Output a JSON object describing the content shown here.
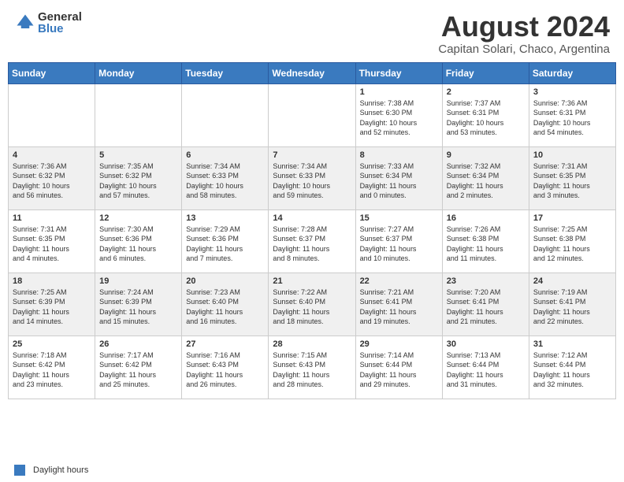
{
  "logo": {
    "general": "General",
    "blue": "Blue"
  },
  "header": {
    "month_year": "August 2024",
    "location": "Capitan Solari, Chaco, Argentina"
  },
  "days_of_week": [
    "Sunday",
    "Monday",
    "Tuesday",
    "Wednesday",
    "Thursday",
    "Friday",
    "Saturday"
  ],
  "footer": {
    "legend_label": "Daylight hours"
  },
  "weeks": [
    [
      {
        "day": "",
        "info": ""
      },
      {
        "day": "",
        "info": ""
      },
      {
        "day": "",
        "info": ""
      },
      {
        "day": "",
        "info": ""
      },
      {
        "day": "1",
        "info": "Sunrise: 7:38 AM\nSunset: 6:30 PM\nDaylight: 10 hours\nand 52 minutes."
      },
      {
        "day": "2",
        "info": "Sunrise: 7:37 AM\nSunset: 6:31 PM\nDaylight: 10 hours\nand 53 minutes."
      },
      {
        "day": "3",
        "info": "Sunrise: 7:36 AM\nSunset: 6:31 PM\nDaylight: 10 hours\nand 54 minutes."
      }
    ],
    [
      {
        "day": "4",
        "info": "Sunrise: 7:36 AM\nSunset: 6:32 PM\nDaylight: 10 hours\nand 56 minutes."
      },
      {
        "day": "5",
        "info": "Sunrise: 7:35 AM\nSunset: 6:32 PM\nDaylight: 10 hours\nand 57 minutes."
      },
      {
        "day": "6",
        "info": "Sunrise: 7:34 AM\nSunset: 6:33 PM\nDaylight: 10 hours\nand 58 minutes."
      },
      {
        "day": "7",
        "info": "Sunrise: 7:34 AM\nSunset: 6:33 PM\nDaylight: 10 hours\nand 59 minutes."
      },
      {
        "day": "8",
        "info": "Sunrise: 7:33 AM\nSunset: 6:34 PM\nDaylight: 11 hours\nand 0 minutes."
      },
      {
        "day": "9",
        "info": "Sunrise: 7:32 AM\nSunset: 6:34 PM\nDaylight: 11 hours\nand 2 minutes."
      },
      {
        "day": "10",
        "info": "Sunrise: 7:31 AM\nSunset: 6:35 PM\nDaylight: 11 hours\nand 3 minutes."
      }
    ],
    [
      {
        "day": "11",
        "info": "Sunrise: 7:31 AM\nSunset: 6:35 PM\nDaylight: 11 hours\nand 4 minutes."
      },
      {
        "day": "12",
        "info": "Sunrise: 7:30 AM\nSunset: 6:36 PM\nDaylight: 11 hours\nand 6 minutes."
      },
      {
        "day": "13",
        "info": "Sunrise: 7:29 AM\nSunset: 6:36 PM\nDaylight: 11 hours\nand 7 minutes."
      },
      {
        "day": "14",
        "info": "Sunrise: 7:28 AM\nSunset: 6:37 PM\nDaylight: 11 hours\nand 8 minutes."
      },
      {
        "day": "15",
        "info": "Sunrise: 7:27 AM\nSunset: 6:37 PM\nDaylight: 11 hours\nand 10 minutes."
      },
      {
        "day": "16",
        "info": "Sunrise: 7:26 AM\nSunset: 6:38 PM\nDaylight: 11 hours\nand 11 minutes."
      },
      {
        "day": "17",
        "info": "Sunrise: 7:25 AM\nSunset: 6:38 PM\nDaylight: 11 hours\nand 12 minutes."
      }
    ],
    [
      {
        "day": "18",
        "info": "Sunrise: 7:25 AM\nSunset: 6:39 PM\nDaylight: 11 hours\nand 14 minutes."
      },
      {
        "day": "19",
        "info": "Sunrise: 7:24 AM\nSunset: 6:39 PM\nDaylight: 11 hours\nand 15 minutes."
      },
      {
        "day": "20",
        "info": "Sunrise: 7:23 AM\nSunset: 6:40 PM\nDaylight: 11 hours\nand 16 minutes."
      },
      {
        "day": "21",
        "info": "Sunrise: 7:22 AM\nSunset: 6:40 PM\nDaylight: 11 hours\nand 18 minutes."
      },
      {
        "day": "22",
        "info": "Sunrise: 7:21 AM\nSunset: 6:41 PM\nDaylight: 11 hours\nand 19 minutes."
      },
      {
        "day": "23",
        "info": "Sunrise: 7:20 AM\nSunset: 6:41 PM\nDaylight: 11 hours\nand 21 minutes."
      },
      {
        "day": "24",
        "info": "Sunrise: 7:19 AM\nSunset: 6:41 PM\nDaylight: 11 hours\nand 22 minutes."
      }
    ],
    [
      {
        "day": "25",
        "info": "Sunrise: 7:18 AM\nSunset: 6:42 PM\nDaylight: 11 hours\nand 23 minutes."
      },
      {
        "day": "26",
        "info": "Sunrise: 7:17 AM\nSunset: 6:42 PM\nDaylight: 11 hours\nand 25 minutes."
      },
      {
        "day": "27",
        "info": "Sunrise: 7:16 AM\nSunset: 6:43 PM\nDaylight: 11 hours\nand 26 minutes."
      },
      {
        "day": "28",
        "info": "Sunrise: 7:15 AM\nSunset: 6:43 PM\nDaylight: 11 hours\nand 28 minutes."
      },
      {
        "day": "29",
        "info": "Sunrise: 7:14 AM\nSunset: 6:44 PM\nDaylight: 11 hours\nand 29 minutes."
      },
      {
        "day": "30",
        "info": "Sunrise: 7:13 AM\nSunset: 6:44 PM\nDaylight: 11 hours\nand 31 minutes."
      },
      {
        "day": "31",
        "info": "Sunrise: 7:12 AM\nSunset: 6:44 PM\nDaylight: 11 hours\nand 32 minutes."
      }
    ]
  ]
}
